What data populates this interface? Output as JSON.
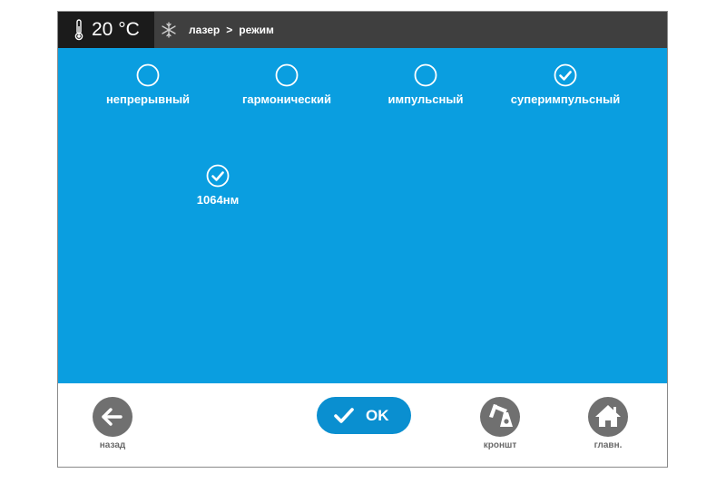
{
  "header": {
    "temperature": "20 °C",
    "breadcrumb": [
      "лазер",
      ">",
      "режим"
    ],
    "thermometer_icon": "thermometer-icon",
    "cooling_icon": "snowflake-icon"
  },
  "modes": [
    {
      "label": "непрерывный",
      "selected": false
    },
    {
      "label": "гармонический",
      "selected": false
    },
    {
      "label": "импульсный",
      "selected": false
    },
    {
      "label": "суперимпульсный",
      "selected": true
    }
  ],
  "wavelengths": [
    {
      "label": "1064нм",
      "selected": true
    }
  ],
  "footer": {
    "back_label": "назад",
    "ok_label": "OK",
    "bracket_label": "кроншт",
    "home_label": "главн."
  },
  "colors": {
    "main_bg": "#0a9ee0",
    "topbar_bg": "#3f3f3f",
    "temp_bg": "#1b1b1b",
    "ok_bg": "#0a8fd0",
    "nav_icon": "#707070"
  }
}
